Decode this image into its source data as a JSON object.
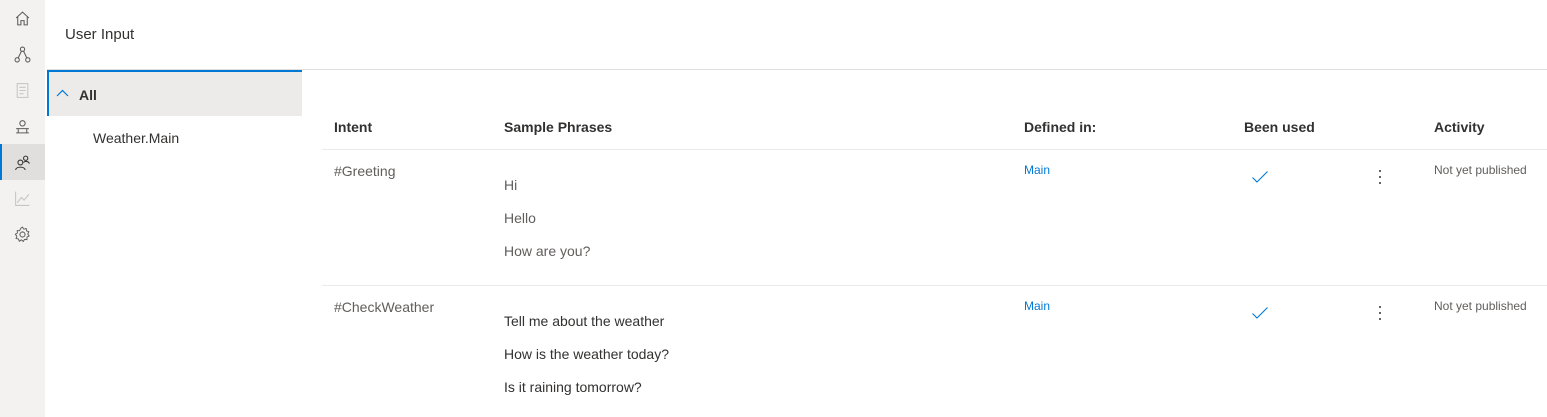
{
  "page": {
    "title": "User Input"
  },
  "rail": {
    "items": [
      {
        "icon": "home-icon"
      },
      {
        "icon": "dialogs-icon"
      },
      {
        "icon": "bot-responses-icon"
      },
      {
        "icon": "bot-icon"
      },
      {
        "icon": "user-input-icon",
        "active": true
      },
      {
        "icon": "analytics-icon"
      },
      {
        "icon": "settings-icon"
      }
    ]
  },
  "tree": {
    "root_label": "All",
    "children": [
      "Weather.Main"
    ]
  },
  "table": {
    "headers": {
      "intent": "Intent",
      "phrases": "Sample Phrases",
      "defined_in": "Defined in:",
      "been_used": "Been used",
      "activity": "Activity"
    },
    "rows": [
      {
        "intent": "#Greeting",
        "phrases": [
          "Hi",
          "Hello",
          "How are you?"
        ],
        "defined_in": "Main",
        "been_used": true,
        "activity": "Not yet published"
      },
      {
        "intent": "#CheckWeather",
        "phrases": [
          "Tell me about the weather",
          "How is the weather today?",
          "Is it raining tomorrow?"
        ],
        "defined_in": "Main",
        "been_used": true,
        "activity": "Not yet published"
      }
    ]
  },
  "colors": {
    "accent": "#0078d4",
    "rail_bg": "#f3f2f1",
    "selected_bg": "#edebe9"
  }
}
